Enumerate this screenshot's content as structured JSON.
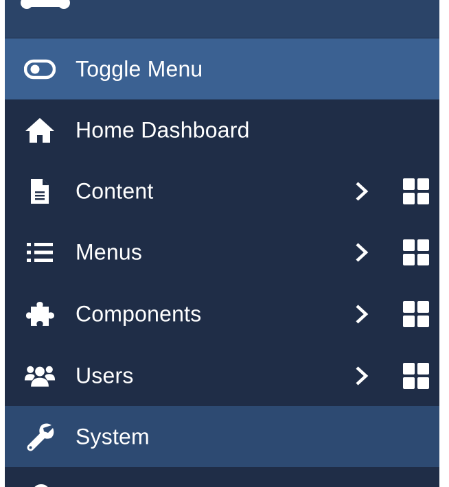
{
  "sidebar": {
    "items": [
      {
        "id": "toggle",
        "label": "Toggle Menu",
        "icon": "toggle-icon",
        "has_submenu": false
      },
      {
        "id": "home",
        "label": "Home Dashboard",
        "icon": "home-icon",
        "has_submenu": false
      },
      {
        "id": "content",
        "label": "Content",
        "icon": "file-icon",
        "has_submenu": true
      },
      {
        "id": "menus",
        "label": "Menus",
        "icon": "list-icon",
        "has_submenu": true
      },
      {
        "id": "components",
        "label": "Components",
        "icon": "puzzle-icon",
        "has_submenu": true
      },
      {
        "id": "users",
        "label": "Users",
        "icon": "users-icon",
        "has_submenu": true
      },
      {
        "id": "system",
        "label": "System",
        "icon": "wrench-icon",
        "has_submenu": false
      }
    ],
    "submenu_icon": "chevron-right-icon",
    "dashboard_icon": "grid-icon"
  },
  "colors": {
    "sidebar_bg": "#1f2d47",
    "top_strip": "#2b4468",
    "toggle_active_bg": "#3b6192",
    "system_highlight_bg": "#2d4a72",
    "text": "#ffffff"
  }
}
